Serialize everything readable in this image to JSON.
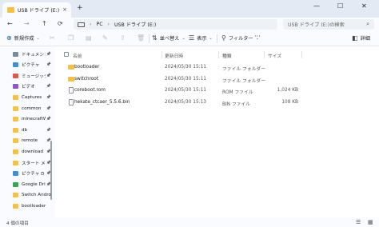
{
  "tab": {
    "title": "USB ドライブ (E:)",
    "close": "×",
    "new": "+"
  },
  "window_controls": {
    "minimize": "—",
    "maximize": "☐",
    "close": "✕"
  },
  "nav": {
    "back": "←",
    "forward": "→",
    "up": "↑",
    "refresh": "⟳"
  },
  "address": {
    "pc": "PC",
    "sep1": "›",
    "drive": "USB ドライブ (E:)",
    "sep2": "›"
  },
  "search": {
    "placeholder": "USB ドライブ (E:)の検索"
  },
  "toolbar": {
    "new_label": "新規作成",
    "sort_label": "並べ替え",
    "view_label": "表示",
    "filter_label": "フィルター",
    "more": "···",
    "details_label": "詳細"
  },
  "sidebar": {
    "items": [
      {
        "label": "ドキュメント",
        "color": "#7b8a9c",
        "pinned": true
      },
      {
        "label": "ピクチャ",
        "color": "#3d8fd6",
        "pinned": true
      },
      {
        "label": "ミュージック",
        "color": "#e2574c",
        "pinned": true
      },
      {
        "label": "ビデオ",
        "color": "#8a58c8",
        "pinned": true
      },
      {
        "label": "Captures",
        "color": "#f4c145",
        "pinned": true
      },
      {
        "label": "common",
        "color": "#f4c145",
        "pinned": true
      },
      {
        "label": "minecraftWo",
        "color": "#f4c145",
        "pinned": true
      },
      {
        "label": "db",
        "color": "#f4c145",
        "pinned": true
      },
      {
        "label": "remote",
        "color": "#f4c145",
        "pinned": true
      },
      {
        "label": "download",
        "color": "#f4c145",
        "pinned": true
      },
      {
        "label": "スタート メニュー",
        "color": "#f4c145",
        "pinned": true
      },
      {
        "label": "ピクチャ D",
        "color": "#3d8fd6",
        "pinned": true
      },
      {
        "label": "Google Drive",
        "color": "#34a853",
        "pinned": true
      },
      {
        "label": "Switch Android",
        "color": "#f4c145",
        "pinned": false
      },
      {
        "label": "bootloader",
        "color": "#f4c145",
        "pinned": false
      }
    ]
  },
  "columns": {
    "name": "名前",
    "modified": "更新日時",
    "type": "種類",
    "size": "サイズ"
  },
  "files": [
    {
      "name": "bootloader",
      "modified": "2024/05/30 15:11",
      "type": "ファイル フォルダー",
      "size": "",
      "kind": "folder"
    },
    {
      "name": "switchroot",
      "modified": "2024/05/30 15:11",
      "type": "ファイル フォルダー",
      "size": "",
      "kind": "folder"
    },
    {
      "name": "coreboot.rom",
      "modified": "2024/05/30 15:11",
      "type": "ROM ファイル",
      "size": "1,024 KB",
      "kind": "file"
    },
    {
      "name": "hekate_ctcaer_5.5.6.bin",
      "modified": "2024/05/30 15:13",
      "type": "BIN ファイル",
      "size": "108 KB",
      "kind": "file"
    }
  ],
  "status": {
    "count": "4 個の項目"
  },
  "colors": {
    "folder": "#f4c145",
    "accent": "#1a62c4"
  }
}
